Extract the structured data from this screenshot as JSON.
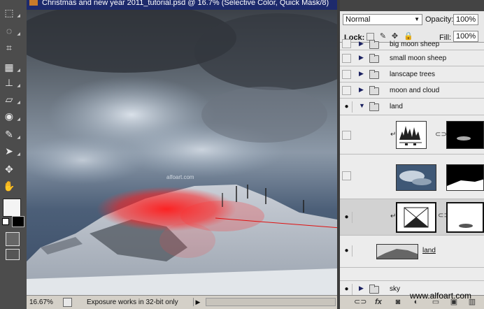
{
  "document": {
    "title": "Christmas and new year 2011_tutorial.psd @ 16.7% (Selective Color, Quick Mask/8)",
    "zoom": "16.67%",
    "status": "Exposure works in 32-bit only",
    "canvas_watermark": "alfoart.com"
  },
  "colors": {
    "accent_red": "#ff2020",
    "title_bar": "#1d2a6c",
    "panel_bg": "#e8e8e8"
  },
  "layers_panel": {
    "blend_mode": "Normal",
    "opacity_label": "Opacity:",
    "opacity": "100%",
    "lock_label": "Lock:",
    "fill_label": "Fill:",
    "fill": "100%",
    "layers": [
      {
        "name": "big moon sheep",
        "type": "group",
        "visible": false
      },
      {
        "name": "small moon sheep",
        "type": "group",
        "visible": false
      },
      {
        "name": "lanscape trees",
        "type": "group",
        "visible": false
      },
      {
        "name": "moon and cloud",
        "type": "group",
        "visible": false
      },
      {
        "name": "land",
        "type": "group",
        "visible": true,
        "expanded": true
      },
      {
        "name": "",
        "type": "levels-adjustment",
        "visible": false
      },
      {
        "name": "",
        "type": "clouds-masked",
        "visible": false
      },
      {
        "name": "",
        "type": "selective-color",
        "visible": true,
        "selected": true
      },
      {
        "name": "land",
        "type": "image",
        "visible": true
      },
      {
        "name": "sky",
        "type": "group",
        "visible": true
      }
    ]
  },
  "watermark": "www.alfoart.com",
  "icons": [
    "marquee-icon",
    "lasso-icon",
    "crop-icon",
    "stamp-icon",
    "eraser-icon",
    "blur-icon",
    "pen-icon",
    "path-select-icon",
    "move-icon",
    "hand-icon",
    "eye-icon",
    "folder-icon",
    "link-icon",
    "fx-icon",
    "mask-icon",
    "adjustment-icon",
    "new-group-icon",
    "new-layer-icon",
    "trash-icon",
    "lock-transparency-icon",
    "lock-move-icon",
    "lock-all-icon"
  ]
}
